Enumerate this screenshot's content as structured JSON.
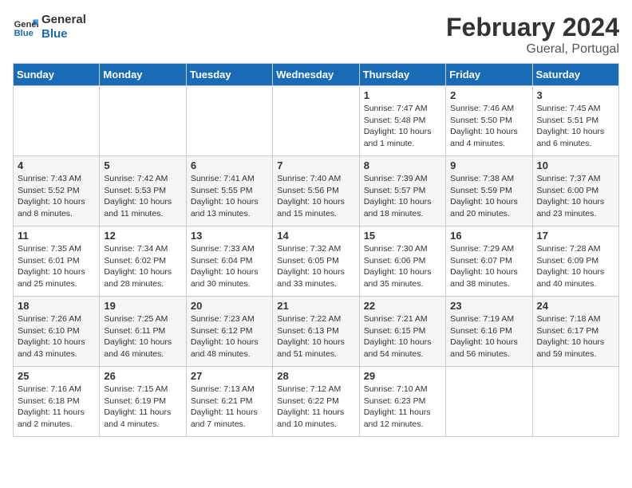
{
  "header": {
    "logo_general": "General",
    "logo_blue": "Blue",
    "title": "February 2024",
    "subtitle": "Gueral, Portugal"
  },
  "columns": [
    "Sunday",
    "Monday",
    "Tuesday",
    "Wednesday",
    "Thursday",
    "Friday",
    "Saturday"
  ],
  "weeks": [
    {
      "days": [
        {
          "number": "",
          "info": ""
        },
        {
          "number": "",
          "info": ""
        },
        {
          "number": "",
          "info": ""
        },
        {
          "number": "",
          "info": ""
        },
        {
          "number": "1",
          "info": "Sunrise: 7:47 AM\nSunset: 5:48 PM\nDaylight: 10 hours\nand 1 minute."
        },
        {
          "number": "2",
          "info": "Sunrise: 7:46 AM\nSunset: 5:50 PM\nDaylight: 10 hours\nand 4 minutes."
        },
        {
          "number": "3",
          "info": "Sunrise: 7:45 AM\nSunset: 5:51 PM\nDaylight: 10 hours\nand 6 minutes."
        }
      ]
    },
    {
      "days": [
        {
          "number": "4",
          "info": "Sunrise: 7:43 AM\nSunset: 5:52 PM\nDaylight: 10 hours\nand 8 minutes."
        },
        {
          "number": "5",
          "info": "Sunrise: 7:42 AM\nSunset: 5:53 PM\nDaylight: 10 hours\nand 11 minutes."
        },
        {
          "number": "6",
          "info": "Sunrise: 7:41 AM\nSunset: 5:55 PM\nDaylight: 10 hours\nand 13 minutes."
        },
        {
          "number": "7",
          "info": "Sunrise: 7:40 AM\nSunset: 5:56 PM\nDaylight: 10 hours\nand 15 minutes."
        },
        {
          "number": "8",
          "info": "Sunrise: 7:39 AM\nSunset: 5:57 PM\nDaylight: 10 hours\nand 18 minutes."
        },
        {
          "number": "9",
          "info": "Sunrise: 7:38 AM\nSunset: 5:59 PM\nDaylight: 10 hours\nand 20 minutes."
        },
        {
          "number": "10",
          "info": "Sunrise: 7:37 AM\nSunset: 6:00 PM\nDaylight: 10 hours\nand 23 minutes."
        }
      ]
    },
    {
      "days": [
        {
          "number": "11",
          "info": "Sunrise: 7:35 AM\nSunset: 6:01 PM\nDaylight: 10 hours\nand 25 minutes."
        },
        {
          "number": "12",
          "info": "Sunrise: 7:34 AM\nSunset: 6:02 PM\nDaylight: 10 hours\nand 28 minutes."
        },
        {
          "number": "13",
          "info": "Sunrise: 7:33 AM\nSunset: 6:04 PM\nDaylight: 10 hours\nand 30 minutes."
        },
        {
          "number": "14",
          "info": "Sunrise: 7:32 AM\nSunset: 6:05 PM\nDaylight: 10 hours\nand 33 minutes."
        },
        {
          "number": "15",
          "info": "Sunrise: 7:30 AM\nSunset: 6:06 PM\nDaylight: 10 hours\nand 35 minutes."
        },
        {
          "number": "16",
          "info": "Sunrise: 7:29 AM\nSunset: 6:07 PM\nDaylight: 10 hours\nand 38 minutes."
        },
        {
          "number": "17",
          "info": "Sunrise: 7:28 AM\nSunset: 6:09 PM\nDaylight: 10 hours\nand 40 minutes."
        }
      ]
    },
    {
      "days": [
        {
          "number": "18",
          "info": "Sunrise: 7:26 AM\nSunset: 6:10 PM\nDaylight: 10 hours\nand 43 minutes."
        },
        {
          "number": "19",
          "info": "Sunrise: 7:25 AM\nSunset: 6:11 PM\nDaylight: 10 hours\nand 46 minutes."
        },
        {
          "number": "20",
          "info": "Sunrise: 7:23 AM\nSunset: 6:12 PM\nDaylight: 10 hours\nand 48 minutes."
        },
        {
          "number": "21",
          "info": "Sunrise: 7:22 AM\nSunset: 6:13 PM\nDaylight: 10 hours\nand 51 minutes."
        },
        {
          "number": "22",
          "info": "Sunrise: 7:21 AM\nSunset: 6:15 PM\nDaylight: 10 hours\nand 54 minutes."
        },
        {
          "number": "23",
          "info": "Sunrise: 7:19 AM\nSunset: 6:16 PM\nDaylight: 10 hours\nand 56 minutes."
        },
        {
          "number": "24",
          "info": "Sunrise: 7:18 AM\nSunset: 6:17 PM\nDaylight: 10 hours\nand 59 minutes."
        }
      ]
    },
    {
      "days": [
        {
          "number": "25",
          "info": "Sunrise: 7:16 AM\nSunset: 6:18 PM\nDaylight: 11 hours\nand 2 minutes."
        },
        {
          "number": "26",
          "info": "Sunrise: 7:15 AM\nSunset: 6:19 PM\nDaylight: 11 hours\nand 4 minutes."
        },
        {
          "number": "27",
          "info": "Sunrise: 7:13 AM\nSunset: 6:21 PM\nDaylight: 11 hours\nand 7 minutes."
        },
        {
          "number": "28",
          "info": "Sunrise: 7:12 AM\nSunset: 6:22 PM\nDaylight: 11 hours\nand 10 minutes."
        },
        {
          "number": "29",
          "info": "Sunrise: 7:10 AM\nSunset: 6:23 PM\nDaylight: 11 hours\nand 12 minutes."
        },
        {
          "number": "",
          "info": ""
        },
        {
          "number": "",
          "info": ""
        }
      ]
    }
  ]
}
